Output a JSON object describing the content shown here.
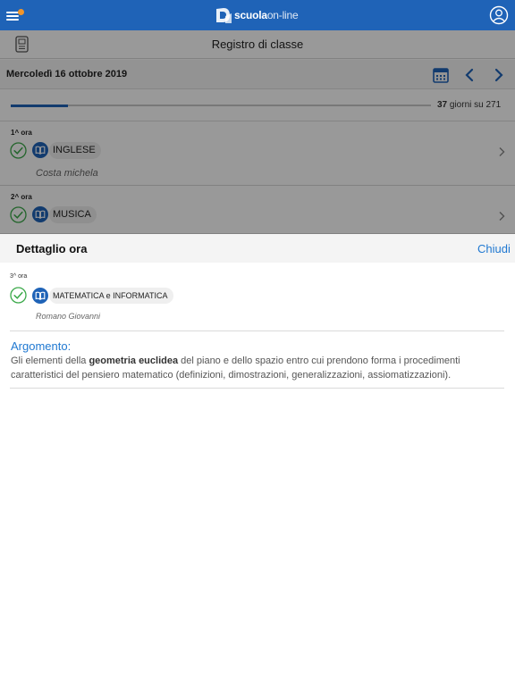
{
  "app": {
    "logo_bold": "scuola",
    "logo_light": "on-line",
    "accent_color": "#1f63b7",
    "link_color": "#1f78d1",
    "notification_dot_color": "#f0952a",
    "icons": {
      "menu": "hamburger-menu-icon",
      "user": "user-profile-icon",
      "register": "register-device-icon",
      "calendar": "calendar-icon",
      "prev": "chevron-left-icon",
      "next": "chevron-right-icon",
      "check": "check-circle-icon",
      "book": "book-icon"
    }
  },
  "header": {
    "title": "Registro di classe"
  },
  "date_bar": {
    "date": "Mercoledì 16 ottobre 2019"
  },
  "progress": {
    "days_done": "37",
    "suffix": " giorni su 271",
    "fraction": 0.1365
  },
  "hours": [
    {
      "label": "1^ ora",
      "subject": "INGLESE",
      "teacher": "Costa michela"
    },
    {
      "label": "2^ ora",
      "subject": "MUSICA"
    }
  ],
  "detail": {
    "title": "Dettaglio ora",
    "close_label": "Chiudi",
    "hour_label": "3^ ora",
    "subject": "MATEMATICA e INFORMATICA",
    "teacher": "Romano Giovanni",
    "topic_title": "Argomento:",
    "topic_text_before": "Gli elementi della ",
    "topic_text_bold": "geometria euclidea",
    "topic_text_after": " del piano e dello spazio entro cui prendono forma i procedimenti caratteristici del pensiero matematico (definizioni, dimostrazioni, generalizzazioni, assiomatizzazioni)."
  }
}
